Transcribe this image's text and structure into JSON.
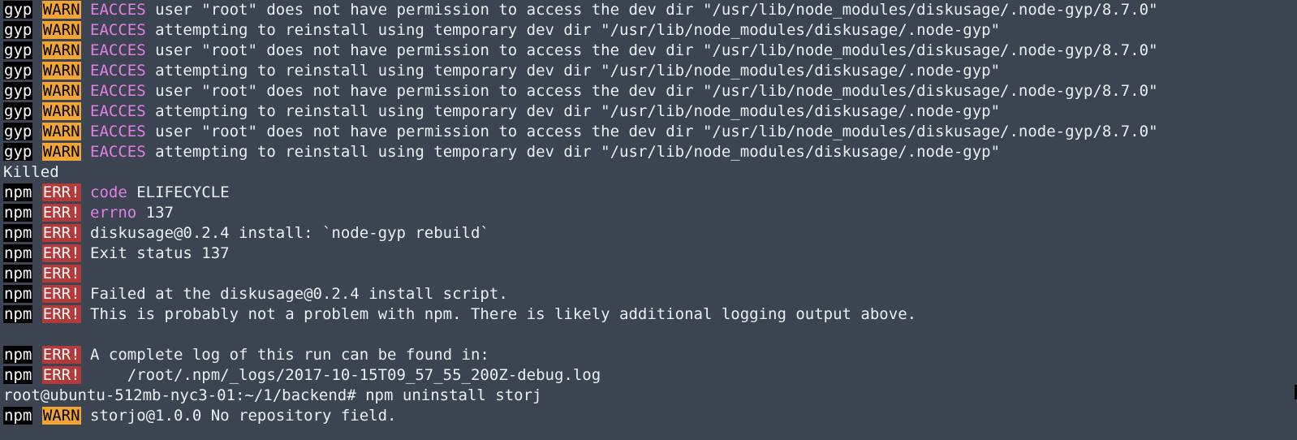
{
  "lines": [
    {
      "prefix": "gyp",
      "level": "WARN",
      "levelType": "warn",
      "keyword": "EACCES",
      "text": "user \"root\" does not have permission to access the dev dir \"/usr/lib/node_modules/diskusage/.node-gyp/8.7.0\""
    },
    {
      "prefix": "gyp",
      "level": "WARN",
      "levelType": "warn",
      "keyword": "EACCES",
      "text": "attempting to reinstall using temporary dev dir \"/usr/lib/node_modules/diskusage/.node-gyp\""
    },
    {
      "prefix": "gyp",
      "level": "WARN",
      "levelType": "warn",
      "keyword": "EACCES",
      "text": "user \"root\" does not have permission to access the dev dir \"/usr/lib/node_modules/diskusage/.node-gyp/8.7.0\""
    },
    {
      "prefix": "gyp",
      "level": "WARN",
      "levelType": "warn",
      "keyword": "EACCES",
      "text": "attempting to reinstall using temporary dev dir \"/usr/lib/node_modules/diskusage/.node-gyp\""
    },
    {
      "prefix": "gyp",
      "level": "WARN",
      "levelType": "warn",
      "keyword": "EACCES",
      "text": "user \"root\" does not have permission to access the dev dir \"/usr/lib/node_modules/diskusage/.node-gyp/8.7.0\""
    },
    {
      "prefix": "gyp",
      "level": "WARN",
      "levelType": "warn",
      "keyword": "EACCES",
      "text": "attempting to reinstall using temporary dev dir \"/usr/lib/node_modules/diskusage/.node-gyp\""
    },
    {
      "prefix": "gyp",
      "level": "WARN",
      "levelType": "warn",
      "keyword": "EACCES",
      "text": "user \"root\" does not have permission to access the dev dir \"/usr/lib/node_modules/diskusage/.node-gyp/8.7.0\""
    },
    {
      "prefix": "gyp",
      "level": "WARN",
      "levelType": "warn",
      "keyword": "EACCES",
      "text": "attempting to reinstall using temporary dev dir \"/usr/lib/node_modules/diskusage/.node-gyp\""
    },
    {
      "plain": "Killed"
    },
    {
      "prefix": "npm",
      "level": "ERR!",
      "levelType": "err",
      "keyword": "code",
      "text": "ELIFECYCLE"
    },
    {
      "prefix": "npm",
      "level": "ERR!",
      "levelType": "err",
      "keyword": "errno",
      "text": "137"
    },
    {
      "prefix": "npm",
      "level": "ERR!",
      "levelType": "err",
      "keyword": "",
      "text": "diskusage@0.2.4 install: `node-gyp rebuild`"
    },
    {
      "prefix": "npm",
      "level": "ERR!",
      "levelType": "err",
      "keyword": "",
      "text": "Exit status 137"
    },
    {
      "prefix": "npm",
      "level": "ERR!",
      "levelType": "err",
      "keyword": "",
      "text": ""
    },
    {
      "prefix": "npm",
      "level": "ERR!",
      "levelType": "err",
      "keyword": "",
      "text": "Failed at the diskusage@0.2.4 install script."
    },
    {
      "prefix": "npm",
      "level": "ERR!",
      "levelType": "err",
      "keyword": "",
      "text": "This is probably not a problem with npm. There is likely additional logging output above."
    },
    {
      "plain": ""
    },
    {
      "prefix": "npm",
      "level": "ERR!",
      "levelType": "err",
      "keyword": "",
      "text": "A complete log of this run can be found in:"
    },
    {
      "prefix": "npm",
      "level": "ERR!",
      "levelType": "err",
      "keyword": "",
      "text": "    /root/.npm/_logs/2017-10-15T09_57_55_200Z-debug.log"
    },
    {
      "plain": "root@ubuntu-512mb-nyc3-01:~/1/backend# npm uninstall storj"
    },
    {
      "prefix": "npm",
      "level": "WARN",
      "levelType": "warn",
      "keyword": "",
      "text": "storjo@1.0.0 No repository field."
    }
  ],
  "colors": {
    "background": "#3b4450",
    "foreground": "#eceff2",
    "warnBadge": "#f0a534",
    "errBadge": "#b33a3a",
    "keyword": "#e47fe6",
    "prefixBadge": "#000000"
  }
}
